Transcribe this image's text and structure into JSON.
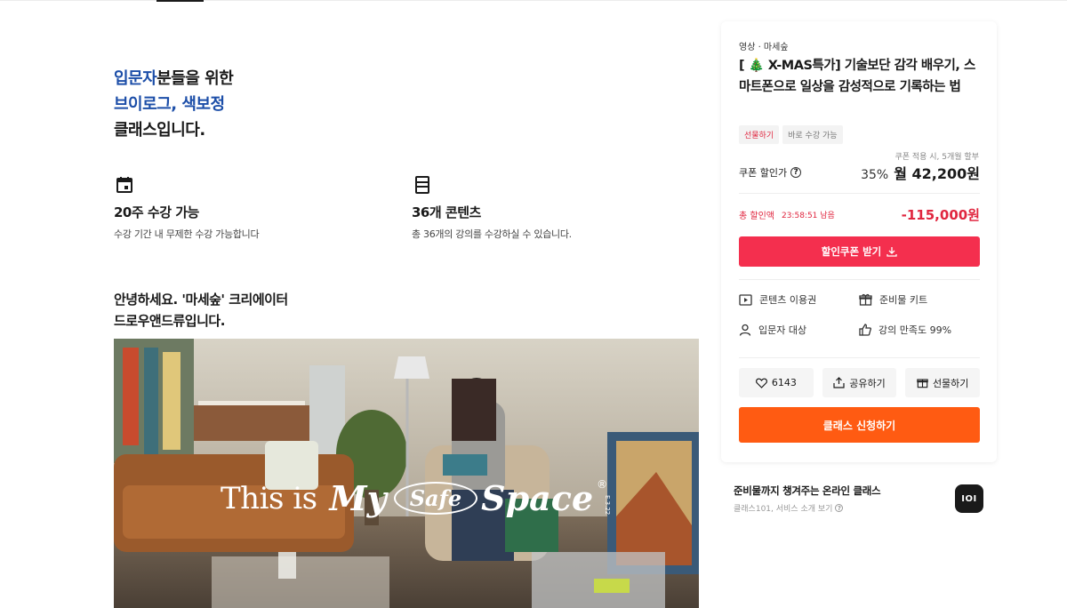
{
  "headline": {
    "line1_blue": "입문자",
    "line1_rest": "분들을 위한",
    "line2": "브이로그, 색보정",
    "line3": "클래스입니다."
  },
  "features": [
    {
      "icon": "calendar-icon",
      "title": "20주 수강 가능",
      "desc": "수강 기간 내 무제한 수강 가능합니다"
    },
    {
      "icon": "book-icon",
      "title": "36개 콘텐츠",
      "desc": "총 36개의 강의를 수강하실 수 있습니다."
    }
  ],
  "intro": {
    "line1": "안녕하세요. '마세숲' 크리에이터",
    "line2": "드로우앤드류입니다."
  },
  "hero": {
    "caption_1": "This is",
    "caption_2": "My",
    "caption_3": "Safe",
    "caption_4": "Space",
    "caption_reg": "®",
    "caption_ed": "E.3.22"
  },
  "card": {
    "category": "영상 · 마세숲",
    "title": "[ 🎄 X-MAS특가] 기술보단 감각 배우기, 스마트폰으로 일상을 감성적으로 기록하는 법",
    "badges": [
      "선물하기",
      "바로 수강 가능"
    ],
    "coupon_note": "쿠폰 적용 시, 5개월 할부",
    "coupon_label": "쿠폰 할인가",
    "coupon_percent": "35%",
    "coupon_price": "월 42,200원",
    "discount_label": "총 할인액",
    "discount_timer": "23:58:51 남음",
    "discount_amount": "-115,000원",
    "coupon_button": "할인쿠폰 받기",
    "info": [
      {
        "icon": "play-icon",
        "label": "콘텐츠 이용권"
      },
      {
        "icon": "gift-icon",
        "label": "준비물 키트"
      },
      {
        "icon": "person-icon",
        "label": "입문자 대상"
      },
      {
        "icon": "thumbs-up-icon",
        "label": "강의 만족도 99%"
      }
    ],
    "like_count": "6143",
    "share_label": "공유하기",
    "gift_label": "선물하기",
    "apply_button": "클래스 신청하기"
  },
  "promo": {
    "title": "준비물까지 챙겨주는 온라인 클래스",
    "sub": "클래스101, 서비스 소개 보기",
    "logo": "IOI"
  },
  "colors": {
    "accent_blue": "#1c4ea8",
    "coupon_red": "#f42f4e",
    "discount_red": "#e0263f",
    "apply_orange": "#ff5b12"
  }
}
